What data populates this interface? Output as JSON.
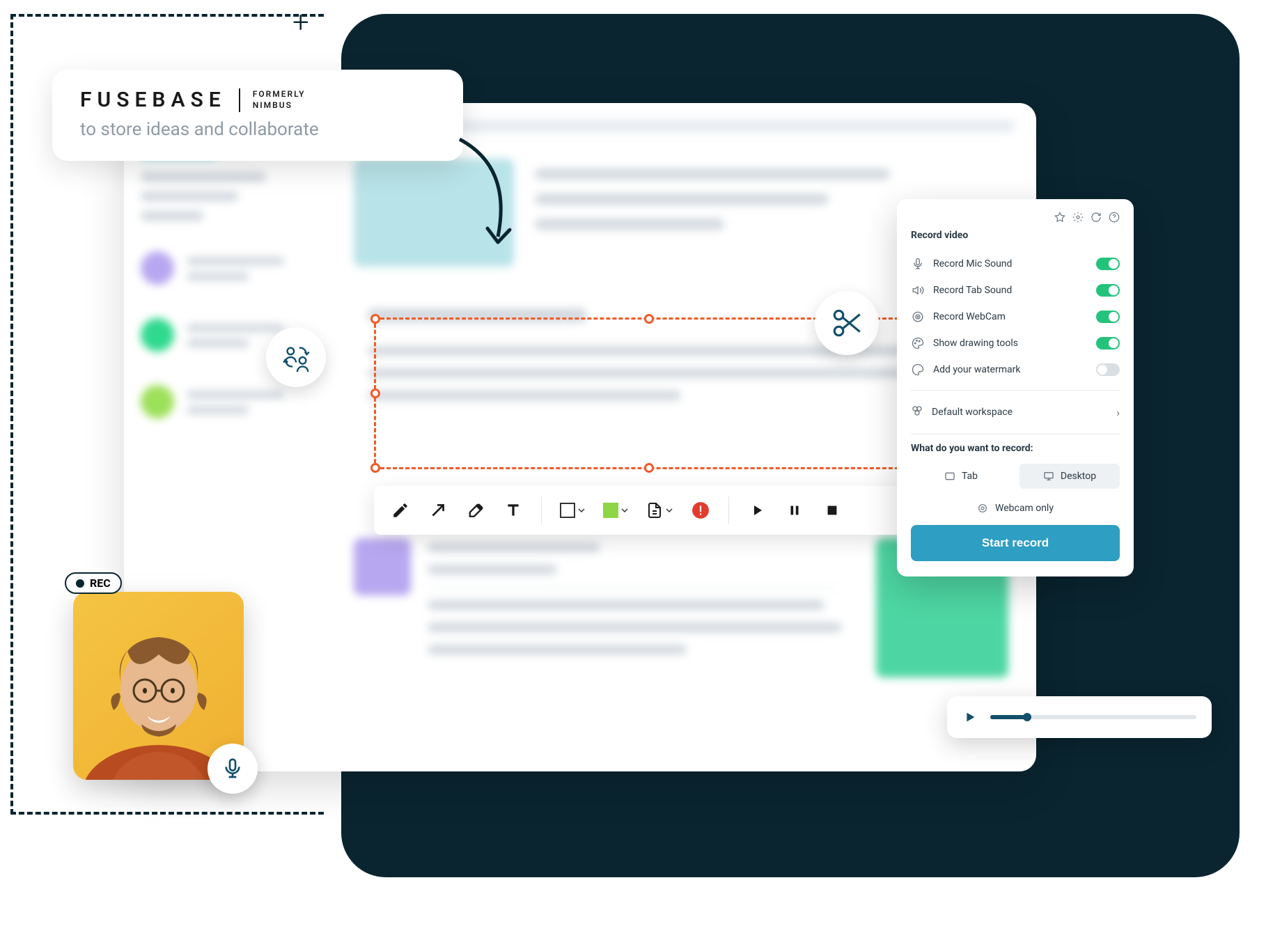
{
  "fuse": {
    "name": "FUSEBASE",
    "sub1": "FORMERLY",
    "sub2": "NIMBUS",
    "tagline": "to store ideas and collaborate"
  },
  "rec_badge": "REC",
  "record_panel": {
    "title": "Record video",
    "rows": {
      "mic": "Record Mic Sound",
      "tab": "Record Tab Sound",
      "webcam": "Record WebCam",
      "drawing": "Show drawing tools",
      "watermark": "Add your watermark"
    },
    "toggles": {
      "mic": true,
      "tab": true,
      "webcam": true,
      "drawing": true,
      "watermark": false
    },
    "workspace": "Default workspace",
    "question": "What do you want to record:",
    "opt_tab": "Tab",
    "opt_desktop": "Desktop",
    "webcam_only": "Webcam only",
    "start": "Start record"
  },
  "colors": {
    "accent": "#f05a28",
    "dark": "#0a2530",
    "toggle_on": "#24c37c",
    "start_btn": "#2e9ec2"
  }
}
